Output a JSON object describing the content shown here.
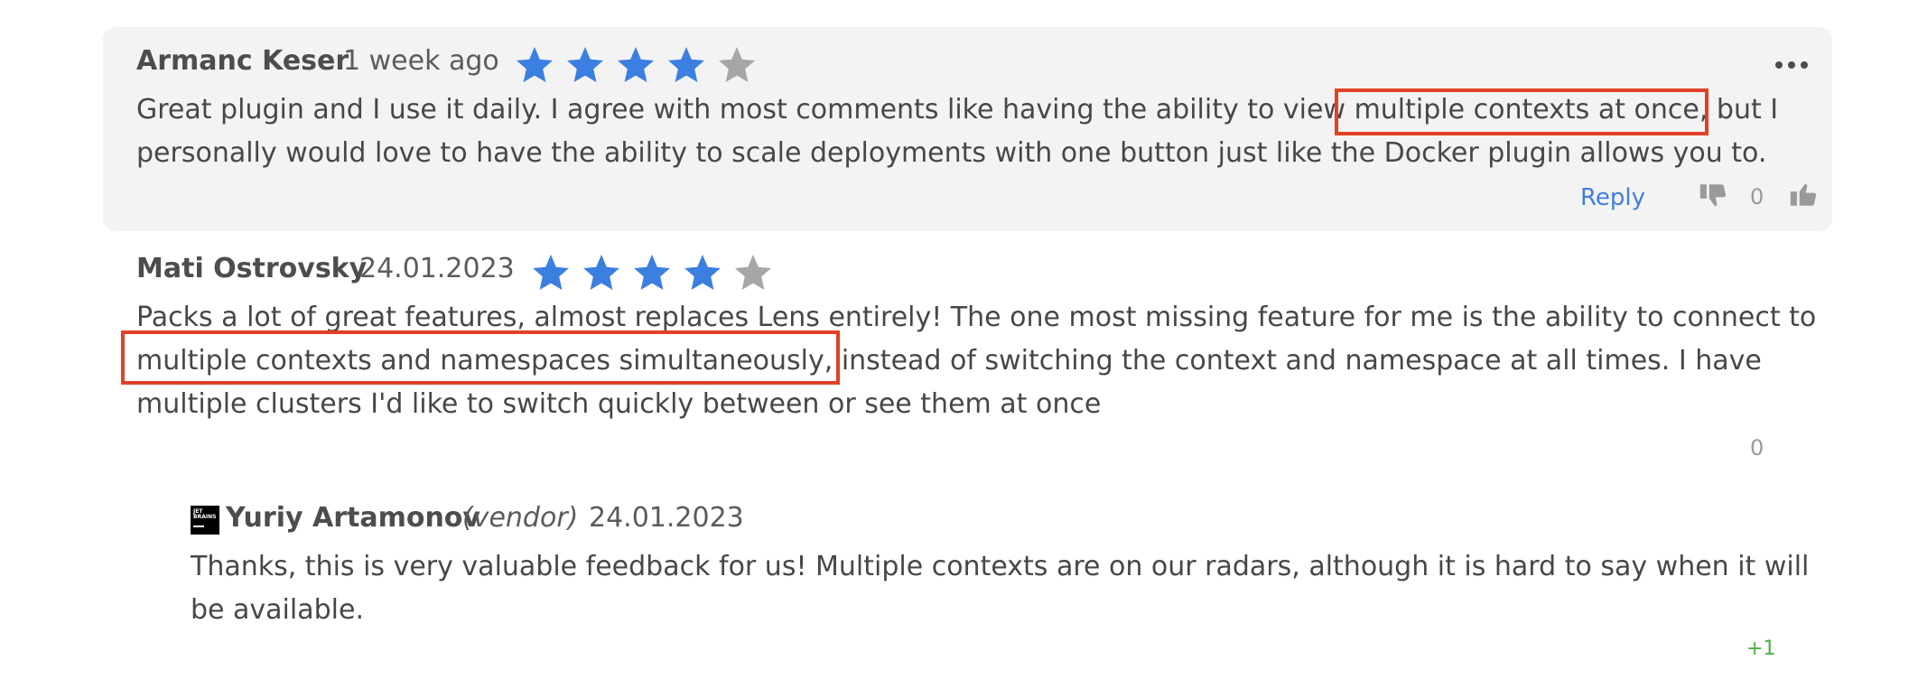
{
  "colors": {
    "star_filled": "#3b7fe0",
    "star_empty": "#a6a6a6",
    "highlight": "#e04128",
    "link": "#3f7fd9",
    "plus": "#4cae4c"
  },
  "reviews": [
    {
      "author": "Armanc Keser",
      "date": "1 week ago",
      "rating": 4,
      "line1_before": "Great plugin and I use it daily. I agree with most comments like having the ability to view ",
      "line1_highlight": "multiple contexts at once,",
      "line1_after": " but I",
      "line2": "personally would love to have the ability to scale deployments with one button just like the Docker plugin allows you to.",
      "reply_label": "Reply",
      "vote_count": "0"
    },
    {
      "author": "Mati Ostrovsky",
      "date": "24.01.2023",
      "rating": 4,
      "line1": "Packs a lot of great features, almost replaces Lens entirely! The one most missing feature for me is the ability to connect to",
      "line2_highlight": "multiple contexts and namespaces simultaneously,",
      "line2_after": " instead of switching the context and namespace at all times. I have",
      "line3": "multiple clusters I'd like to switch quickly between or see them at once",
      "vote_count": "0"
    }
  ],
  "vendor_reply": {
    "logo_text": "JET BRAINS",
    "author": "Yuriy Artamonov",
    "tag": "(vendor)",
    "date": "24.01.2023",
    "line1": "Thanks, this is very valuable feedback for us! Multiple contexts are on our radars, although it is hard to say when it will",
    "line2": "be available.",
    "vote": "+1"
  }
}
